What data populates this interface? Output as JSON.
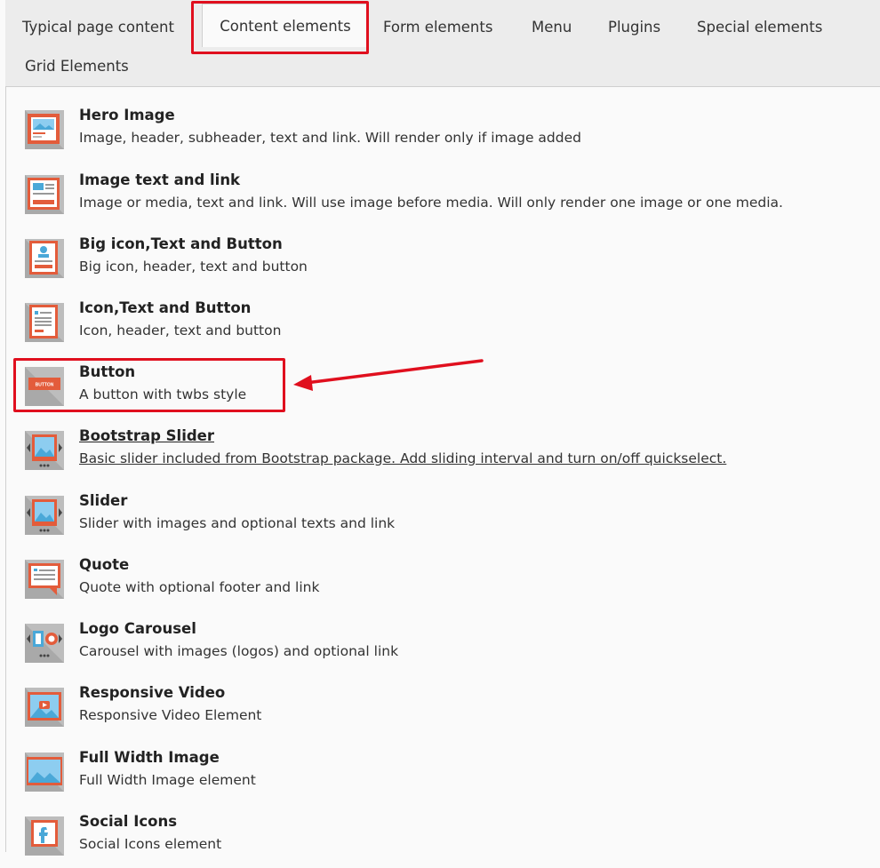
{
  "tabs": [
    {
      "label": "Typical page content"
    },
    {
      "label": "Content elements"
    },
    {
      "label": "Form elements"
    },
    {
      "label": "Menu"
    },
    {
      "label": "Plugins"
    },
    {
      "label": "Special elements"
    },
    {
      "label": "Grid Elements"
    }
  ],
  "active_tab": "Content elements",
  "items": [
    {
      "title": "Hero Image",
      "desc": "Image, header, subheader, text and link. Will render only if image added",
      "icon": "hero-image-icon"
    },
    {
      "title": "Image text and link",
      "desc": "Image or media, text and link. Will use image before media. Will only render one image or one media.",
      "icon": "image-text-link-icon"
    },
    {
      "title": "Big icon,Text and Button",
      "desc": "Big icon, header, text and button",
      "icon": "big-icon-text-button-icon"
    },
    {
      "title": "Icon,Text and Button",
      "desc": "Icon, header, text and button",
      "icon": "icon-text-button-icon"
    },
    {
      "title": "Button",
      "desc": "A button with twbs style",
      "icon": "button-icon",
      "icon_text": "BUTTON"
    },
    {
      "title": "Bootstrap Slider ",
      "desc": "Basic slider included from Bootstrap package. Add sliding interval and turn on/off quickselect.",
      "icon": "bootstrap-slider-icon"
    },
    {
      "title": "Slider",
      "desc": "Slider with images and optional texts and link",
      "icon": "slider-icon"
    },
    {
      "title": "Quote",
      "desc": "Quote with optional footer and link",
      "icon": "quote-icon"
    },
    {
      "title": "Logo Carousel",
      "desc": "Carousel with images (logos) and optional link",
      "icon": "logo-carousel-icon"
    },
    {
      "title": "Responsive Video",
      "desc": "Responsive Video Element",
      "icon": "responsive-video-icon"
    },
    {
      "title": "Full Width Image",
      "desc": "Full Width Image element",
      "icon": "full-width-image-icon"
    },
    {
      "title": "Social Icons",
      "desc": "Social Icons element",
      "icon": "social-icons-icon"
    }
  ],
  "colors": {
    "accent": "#e00f1e",
    "icon_orange": "#e35c3b",
    "icon_blue": "#4aa8d8",
    "icon_grey": "#bdbdbd"
  }
}
